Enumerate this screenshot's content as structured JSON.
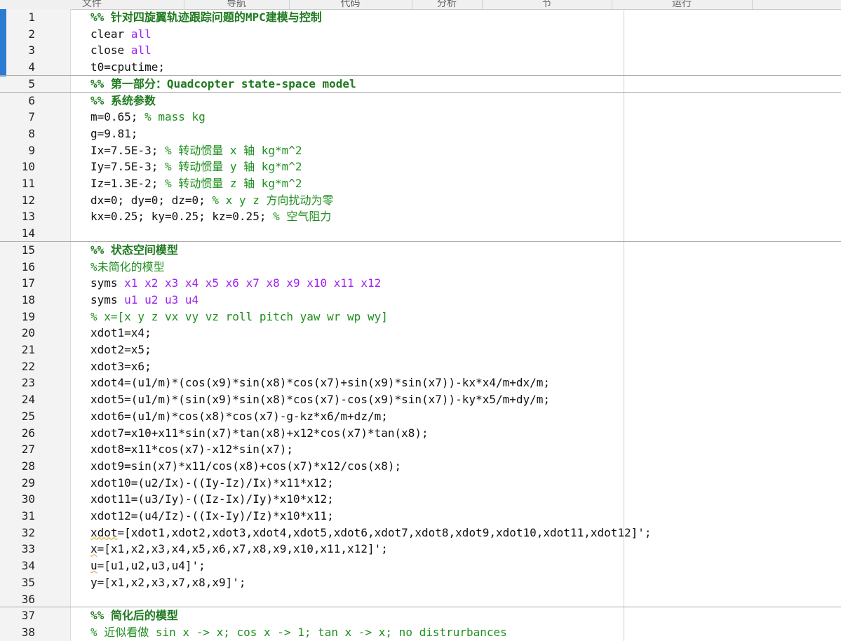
{
  "toolstrip": {
    "sections": [
      "文件",
      "导航",
      "代码",
      "分析",
      "节",
      "运行"
    ]
  },
  "editor": {
    "lines": [
      {
        "n": "1",
        "seg": [
          {
            "t": "%% 针对四旋翼轨迹跟踪问题的MPC建模与控制",
            "c": "cell-title"
          }
        ]
      },
      {
        "n": "2",
        "seg": [
          {
            "t": "clear "
          },
          {
            "t": "all",
            "c": "kw"
          }
        ]
      },
      {
        "n": "3",
        "seg": [
          {
            "t": "close "
          },
          {
            "t": "all",
            "c": "kw"
          }
        ]
      },
      {
        "n": "4",
        "seg": [
          {
            "t": "t0=cputime;"
          }
        ]
      },
      {
        "n": "5",
        "seg": [
          {
            "t": "%% 第一部分：Quadcopter state-space model",
            "c": "cell-title"
          }
        ]
      },
      {
        "n": "6",
        "seg": [
          {
            "t": "%% 系统参数",
            "c": "cell-title"
          }
        ]
      },
      {
        "n": "7",
        "seg": [
          {
            "t": "m=0.65; "
          },
          {
            "t": "% mass kg",
            "c": "cmt"
          }
        ]
      },
      {
        "n": "8",
        "seg": [
          {
            "t": "g=9.81;"
          }
        ]
      },
      {
        "n": "9",
        "seg": [
          {
            "t": "Ix=7.5E-3; "
          },
          {
            "t": "% 转动惯量 x 轴 kg*m^2",
            "c": "cmt"
          }
        ]
      },
      {
        "n": "10",
        "seg": [
          {
            "t": "Iy=7.5E-3; "
          },
          {
            "t": "% 转动惯量 y 轴 kg*m^2",
            "c": "cmt"
          }
        ]
      },
      {
        "n": "11",
        "seg": [
          {
            "t": "Iz=1.3E-2; "
          },
          {
            "t": "% 转动惯量 z 轴 kg*m^2",
            "c": "cmt"
          }
        ]
      },
      {
        "n": "12",
        "seg": [
          {
            "t": "dx=0; dy=0; dz=0; "
          },
          {
            "t": "% x y z 方向扰动为零",
            "c": "cmt"
          }
        ]
      },
      {
        "n": "13",
        "seg": [
          {
            "t": "kx=0.25; ky=0.25; kz=0.25; "
          },
          {
            "t": "% 空气阻力",
            "c": "cmt"
          }
        ]
      },
      {
        "n": "14",
        "seg": []
      },
      {
        "n": "15",
        "seg": [
          {
            "t": "%% 状态空间模型",
            "c": "cell-title"
          }
        ]
      },
      {
        "n": "16",
        "seg": [
          {
            "t": "%未简化的模型",
            "c": "cmt"
          }
        ]
      },
      {
        "n": "17",
        "seg": [
          {
            "t": "syms "
          },
          {
            "t": "x1 x2 x3 x4 x5 x6 x7 x8 x9 x10 x11 x12",
            "c": "kw"
          }
        ]
      },
      {
        "n": "18",
        "seg": [
          {
            "t": "syms "
          },
          {
            "t": "u1 u2 u3 u4",
            "c": "kw"
          }
        ]
      },
      {
        "n": "19",
        "seg": [
          {
            "t": "% x=[x y z vx vy vz roll pitch yaw wr wp wy]",
            "c": "cmt"
          }
        ]
      },
      {
        "n": "20",
        "seg": [
          {
            "t": "xdot1=x4;"
          }
        ]
      },
      {
        "n": "21",
        "seg": [
          {
            "t": "xdot2=x5;"
          }
        ]
      },
      {
        "n": "22",
        "seg": [
          {
            "t": "xdot3=x6;"
          }
        ]
      },
      {
        "n": "23",
        "seg": [
          {
            "t": "xdot4=(u1/m)*(cos(x9)*sin(x8)*cos(x7)+sin(x9)*sin(x7))-kx*x4/m+dx/m;"
          }
        ]
      },
      {
        "n": "24",
        "seg": [
          {
            "t": "xdot5=(u1/m)*(sin(x9)*sin(x8)*cos(x7)-cos(x9)*sin(x7))-ky*x5/m+dy/m;"
          }
        ]
      },
      {
        "n": "25",
        "seg": [
          {
            "t": "xdot6=(u1/m)*cos(x8)*cos(x7)-g-kz*x6/m+dz/m;"
          }
        ]
      },
      {
        "n": "26",
        "seg": [
          {
            "t": "xdot7=x10+x11*sin(x7)*tan(x8)+x12*cos(x7)*tan(x8);"
          }
        ]
      },
      {
        "n": "27",
        "seg": [
          {
            "t": "xdot8=x11*cos(x7)-x12*sin(x7);"
          }
        ]
      },
      {
        "n": "28",
        "seg": [
          {
            "t": "xdot9=sin(x7)*x11/cos(x8)+cos(x7)*x12/cos(x8);"
          }
        ]
      },
      {
        "n": "29",
        "seg": [
          {
            "t": "xdot10=(u2/Ix)-((Iy-Iz)/Ix)*x11*x12;"
          }
        ]
      },
      {
        "n": "30",
        "seg": [
          {
            "t": "xdot11=(u3/Iy)-((Iz-Ix)/Iy)*x10*x12;"
          }
        ]
      },
      {
        "n": "31",
        "seg": [
          {
            "t": "xdot12=(u4/Iz)-((Ix-Iy)/Iz)*x10*x11;"
          }
        ]
      },
      {
        "n": "32",
        "seg": [
          {
            "t": "xdot",
            "c": "squig"
          },
          {
            "t": "=[xdot1,xdot2,xdot3,xdot4,xdot5,xdot6,xdot7,xdot8,xdot9,xdot10,xdot11,xdot12]';"
          }
        ]
      },
      {
        "n": "33",
        "seg": [
          {
            "t": "x",
            "c": "squig"
          },
          {
            "t": "=[x1,x2,x3,x4,x5,x6,x7,x8,x9,x10,x11,x12]';"
          }
        ]
      },
      {
        "n": "34",
        "seg": [
          {
            "t": "u",
            "c": "squig"
          },
          {
            "t": "=[u1,u2,u3,u4]';"
          }
        ]
      },
      {
        "n": "35",
        "seg": [
          {
            "t": "y=[x1,x2,x3,x7,x8,x9]';"
          }
        ]
      },
      {
        "n": "36",
        "seg": []
      },
      {
        "n": "37",
        "seg": [
          {
            "t": "%% 简化后的模型",
            "c": "cell-title"
          }
        ]
      },
      {
        "n": "38",
        "seg": [
          {
            "t": "% 近似看做 sin x -> x; cos x -> 1; tan x -> x; no distrurbances",
            "c": "cmt"
          }
        ]
      }
    ],
    "cell_breaks_before": [
      5,
      6,
      15,
      37
    ]
  }
}
